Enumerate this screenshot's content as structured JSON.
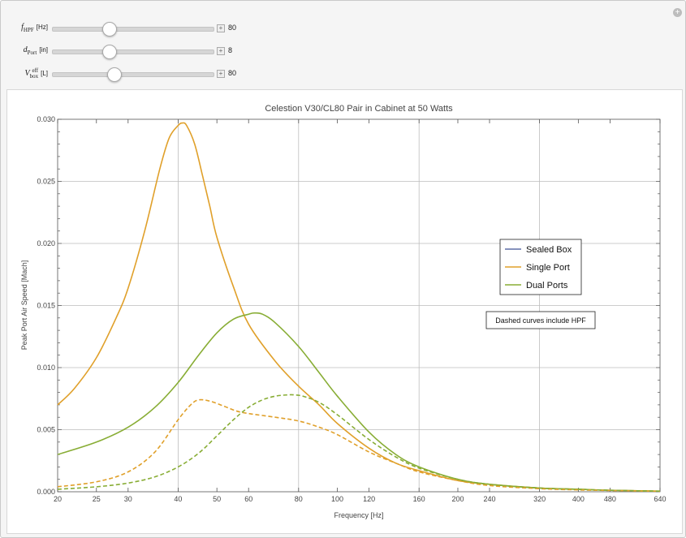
{
  "controls": [
    {
      "id": "fhpf",
      "label_main": "f",
      "label_sub": "HPF",
      "label_sup": "",
      "unit": "[Hz]",
      "value": "80",
      "fraction": 0.35
    },
    {
      "id": "dport",
      "label_main": "d",
      "label_sub": "Port",
      "label_sup": "",
      "unit": "[in]",
      "value": "8",
      "fraction": 0.35
    },
    {
      "id": "vbox",
      "label_main": "V",
      "label_sub": "box",
      "label_sup": "eff",
      "unit": "[L]",
      "value": "80",
      "fraction": 0.38
    }
  ],
  "colors": {
    "sealed": "#5e6ea7",
    "single": "#e0a02a",
    "dual": "#88ad35"
  },
  "chart_data": {
    "type": "line",
    "title": "Celestion V30/CL80 Pair in Cabinet at 50 Watts",
    "xlabel": "Frequency [Hz]",
    "ylabel": "Peak Port Air Speed [Mach]",
    "xscale": "log",
    "xlim": [
      20,
      640
    ],
    "ylim": [
      0,
      0.03
    ],
    "xticks": [
      20,
      25,
      30,
      40,
      50,
      60,
      80,
      100,
      120,
      160,
      200,
      240,
      320,
      400,
      480,
      640
    ],
    "xtick_labels": [
      "20",
      "25",
      "30",
      "40",
      "50",
      "60",
      "80",
      "100",
      "120",
      "160",
      "200",
      "240",
      "320",
      "400",
      "480",
      "640"
    ],
    "yticks": [
      0,
      0.005,
      0.01,
      0.015,
      0.02,
      0.025,
      0.03
    ],
    "ytick_labels": [
      "0.000",
      "0.005",
      "0.010",
      "0.015",
      "0.020",
      "0.025",
      "0.030"
    ],
    "xgrid": [
      40,
      80,
      160,
      320
    ],
    "ygrid": [
      0.005,
      0.01,
      0.015,
      0.02,
      0.025
    ],
    "legend": {
      "position": "right",
      "entries": [
        "Sealed Box",
        "Single Port",
        "Dual Ports"
      ]
    },
    "annotation": "Dashed curves include HPF",
    "series": [
      {
        "name": "Single Port",
        "style": "solid",
        "color_key": "single",
        "x": [
          20,
          22,
          25,
          28,
          30,
          33,
          36,
          38,
          40,
          41,
          42,
          44,
          46,
          48,
          50,
          55,
          60,
          70,
          80,
          90,
          100,
          120,
          140,
          160,
          200,
          240,
          320,
          400,
          480,
          640
        ],
        "y": [
          0.007,
          0.0083,
          0.0108,
          0.014,
          0.0164,
          0.021,
          0.026,
          0.0285,
          0.0295,
          0.0297,
          0.0295,
          0.028,
          0.0255,
          0.023,
          0.0205,
          0.0165,
          0.0135,
          0.0105,
          0.0085,
          0.007,
          0.0055,
          0.0035,
          0.0023,
          0.0017,
          0.0009,
          0.0006,
          0.0003,
          0.0002,
          0.00012,
          5e-05
        ]
      },
      {
        "name": "Dual Ports",
        "style": "solid",
        "color_key": "dual",
        "x": [
          20,
          25,
          30,
          35,
          40,
          45,
          50,
          55,
          60,
          62,
          65,
          70,
          80,
          90,
          100,
          120,
          140,
          160,
          200,
          240,
          320,
          400,
          480,
          640
        ],
        "y": [
          0.003,
          0.004,
          0.0052,
          0.0068,
          0.0088,
          0.011,
          0.0128,
          0.0139,
          0.0143,
          0.0144,
          0.0143,
          0.0136,
          0.0117,
          0.0096,
          0.0077,
          0.0048,
          0.003,
          0.002,
          0.001,
          0.0006,
          0.0003,
          0.0002,
          0.00012,
          5e-05
        ]
      },
      {
        "name": "Single Port (HPF)",
        "style": "dashed",
        "color_key": "single",
        "x": [
          20,
          25,
          30,
          35,
          40,
          43,
          45,
          48,
          52,
          56,
          60,
          70,
          80,
          90,
          100,
          120,
          140,
          160,
          200,
          240,
          320,
          400,
          480,
          640
        ],
        "y": [
          0.0004,
          0.0008,
          0.0016,
          0.0032,
          0.0058,
          0.007,
          0.0074,
          0.0073,
          0.0069,
          0.0065,
          0.0063,
          0.006,
          0.0057,
          0.0052,
          0.0046,
          0.0032,
          0.0023,
          0.0016,
          0.0009,
          0.0005,
          0.00025,
          0.00015,
          0.0001,
          4e-05
        ]
      },
      {
        "name": "Dual Ports (HPF)",
        "style": "dashed",
        "color_key": "dual",
        "x": [
          20,
          25,
          30,
          35,
          40,
          45,
          50,
          55,
          60,
          65,
          70,
          75,
          78,
          82,
          90,
          100,
          120,
          140,
          160,
          200,
          240,
          320,
          400,
          480,
          640
        ],
        "y": [
          0.0002,
          0.0004,
          0.0007,
          0.0012,
          0.002,
          0.0031,
          0.0045,
          0.0058,
          0.0068,
          0.0074,
          0.0077,
          0.0078,
          0.0078,
          0.0077,
          0.0072,
          0.0062,
          0.0042,
          0.0028,
          0.0019,
          0.001,
          0.0006,
          0.0003,
          0.0002,
          0.00012,
          5e-05
        ]
      }
    ]
  }
}
